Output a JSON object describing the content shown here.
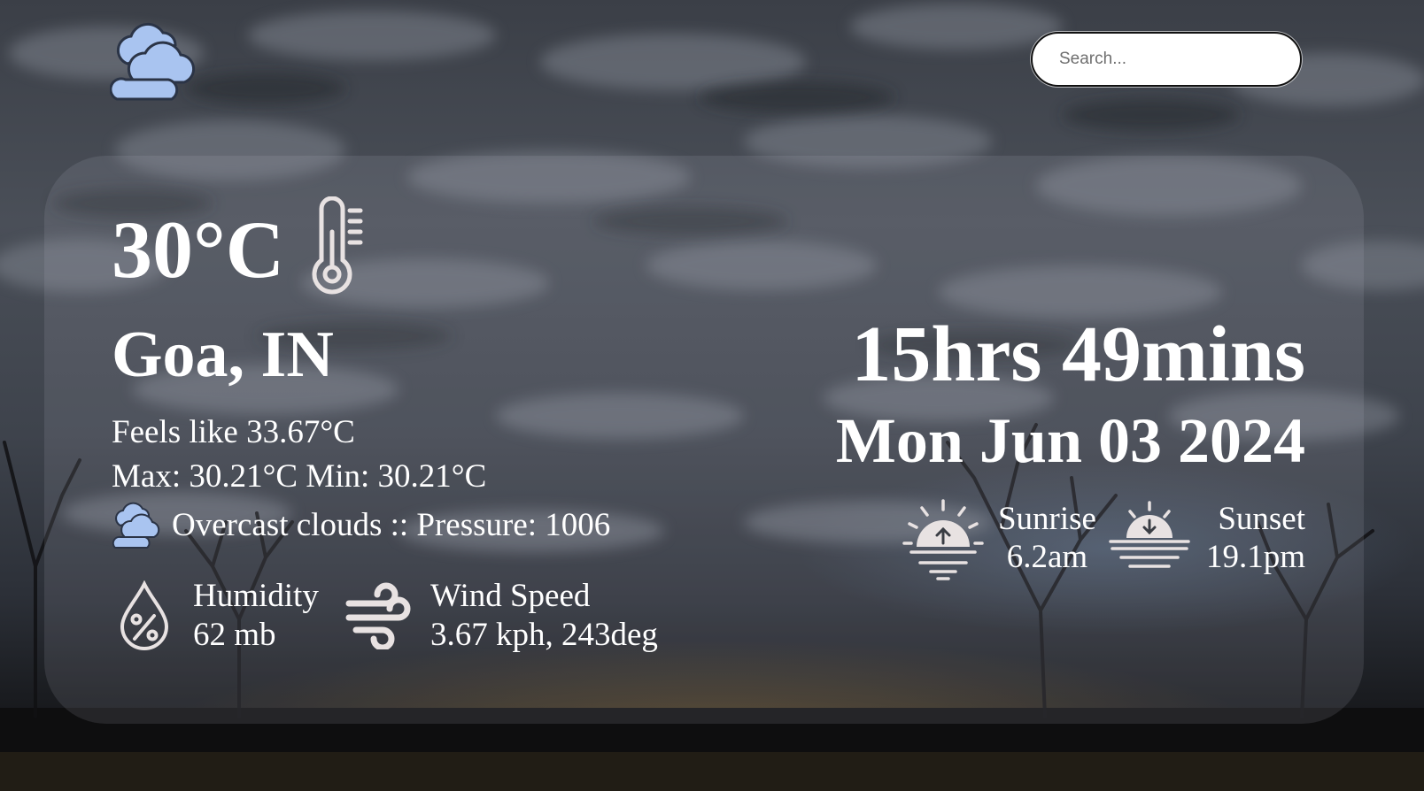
{
  "search": {
    "placeholder": "Search..."
  },
  "current": {
    "temperature": "30°C",
    "location": "Goa, IN",
    "feels_like": "Feels like 33.67°C",
    "max_min": "Max: 30.21°C Min: 30.21°C",
    "condition": "Overcast clouds :: Pressure: 1006"
  },
  "stats": {
    "humidity_label": "Humidity",
    "humidity_value": "62 mb",
    "wind_label": "Wind Speed",
    "wind_value": "3.67 kph, 243deg"
  },
  "day": {
    "length": "15hrs 49mins",
    "date": "Mon Jun 03 2024",
    "sunrise_label": "Sunrise",
    "sunrise_value": "6.2am",
    "sunset_label": "Sunset",
    "sunset_value": "19.1pm"
  },
  "icons": {
    "logo": "cloud-icon",
    "temperature": "thermometer-icon",
    "condition": "cloud-icon",
    "humidity": "humidity-drop-icon",
    "wind": "wind-icon",
    "sunrise": "sunrise-icon",
    "sunset": "sunset-icon"
  },
  "colors": {
    "cloud_icon": "#a9c4f0",
    "icon_line": "#e8e2e2",
    "text": "#ffffff"
  }
}
